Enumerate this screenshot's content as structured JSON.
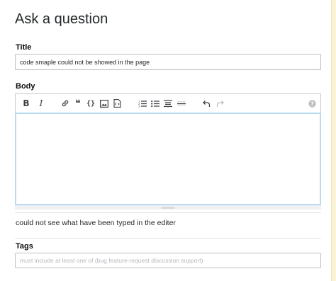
{
  "page": {
    "title": "Ask a question"
  },
  "title_field": {
    "label": "Title",
    "value": "code smaple could not be showed in the page"
  },
  "body_field": {
    "label": "Body",
    "value": "",
    "toolbar": [
      {
        "id": "bold",
        "icon": "bold-icon",
        "glyph": "B"
      },
      {
        "id": "italic",
        "icon": "italic-icon",
        "glyph": "I"
      },
      {
        "id": "link",
        "icon": "link-icon"
      },
      {
        "id": "blockquote",
        "icon": "blockquote-icon",
        "glyph": "❝"
      },
      {
        "id": "code",
        "icon": "code-icon",
        "glyph": "{}"
      },
      {
        "id": "image",
        "icon": "image-icon"
      },
      {
        "id": "snippet",
        "icon": "snippet-icon"
      },
      {
        "id": "ordered-list",
        "icon": "ordered-list-icon"
      },
      {
        "id": "bullet-list",
        "icon": "bullet-list-icon"
      },
      {
        "id": "heading",
        "icon": "heading-icon"
      },
      {
        "id": "horizontal-rule",
        "icon": "horizontal-rule-icon"
      },
      {
        "id": "undo",
        "icon": "undo-icon"
      },
      {
        "id": "redo",
        "icon": "redo-icon"
      },
      {
        "id": "help",
        "icon": "help-icon",
        "glyph": "?"
      }
    ]
  },
  "preview": {
    "text": "could not see what have been typed in the editer"
  },
  "tags_field": {
    "label": "Tags",
    "placeholder": "must include at least one of (bug feature-request discussion support)"
  },
  "colors": {
    "editor_focus_border": "#b8dbf2",
    "input_border": "#bbc0c4",
    "sidebar_notice": "#fbf3d5"
  }
}
